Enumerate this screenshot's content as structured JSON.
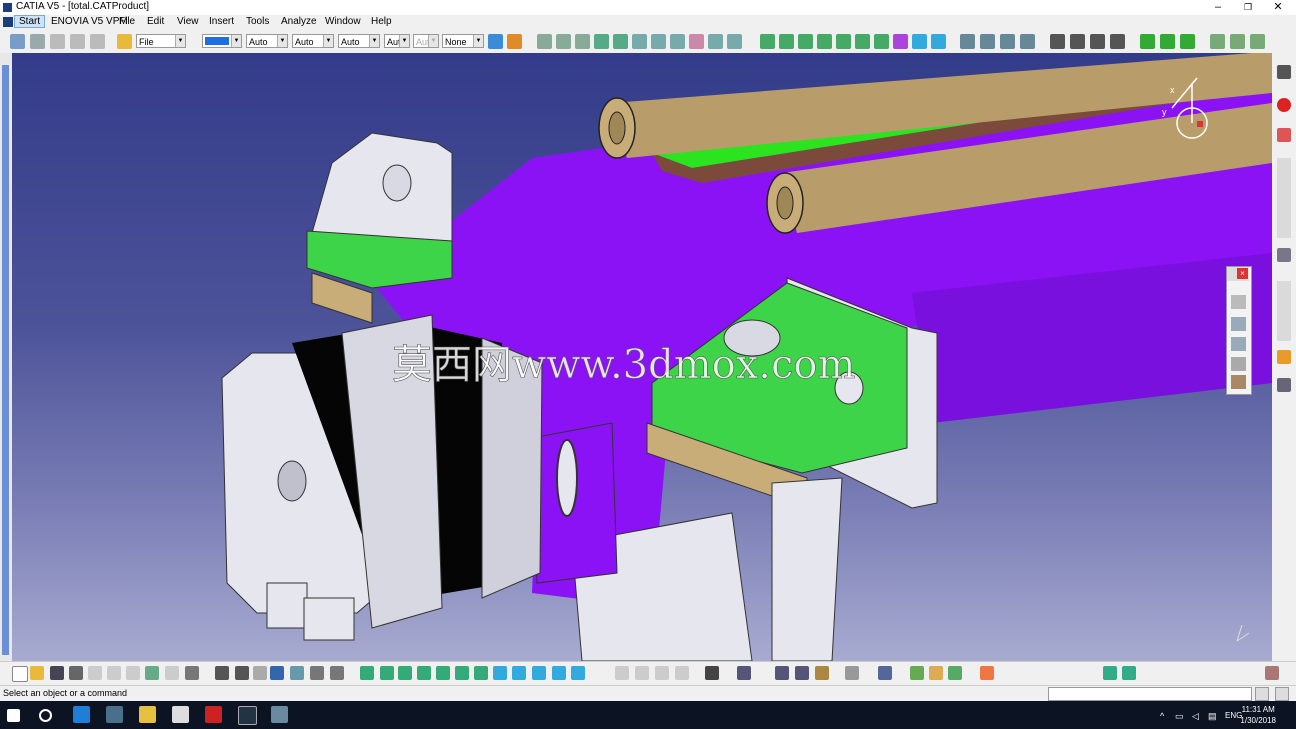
{
  "window": {
    "title": "CATIA V5 - [total.CATProduct]",
    "controls": {
      "minimize": "–",
      "restore": "❐",
      "close": "✕"
    }
  },
  "menubar": {
    "items": [
      "Start",
      "ENOVIA V5 VPM",
      "File",
      "Edit",
      "View",
      "Insert",
      "Tools",
      "Analyze",
      "Window",
      "Help"
    ]
  },
  "toolbar": {
    "file_combo": "File",
    "combo_auto1": "Auto",
    "combo_auto2": "Auto",
    "combo_auto3": "Auto",
    "combo_aut": "Aut",
    "combo_aut2": "Aut",
    "combo_none": "None",
    "fill_color": "#1e6fe0"
  },
  "viewport": {
    "watermark": "莫西网www.3dmox.com",
    "compass_label": "x y z"
  },
  "colors": {
    "purple_part": "#8a12f5",
    "green_part": "#3ed44a",
    "rod_tan": "#b89d6a",
    "grey_part": "#e6e6ee",
    "motor_black": "#050505"
  },
  "status": {
    "prompt": "Select an object or a command"
  },
  "taskbar": {
    "time": "11:31 AM",
    "date": "1/30/2018",
    "lang": "ENG"
  }
}
